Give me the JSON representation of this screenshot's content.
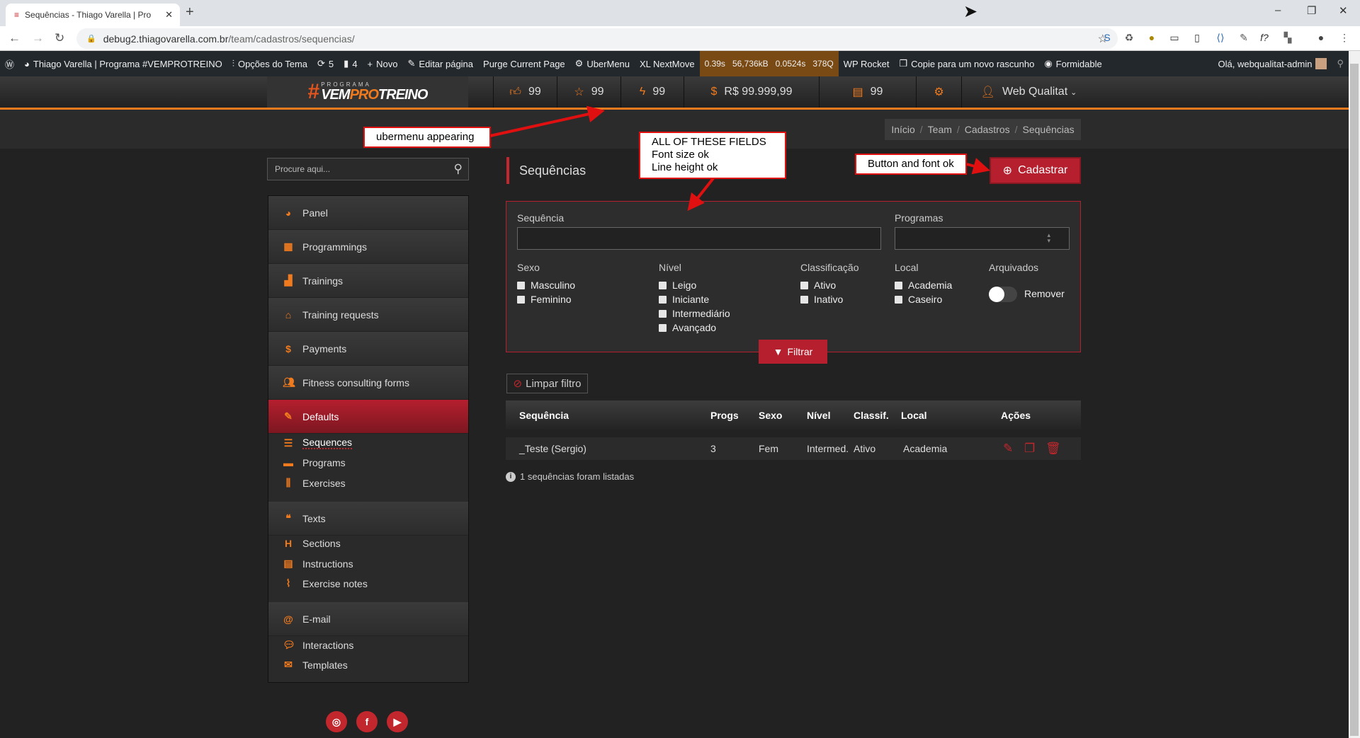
{
  "browser": {
    "tab_title": "Sequências - Thiago Varella | Pro",
    "url_host": "debug2.thiagovarella.com.br",
    "url_path": "/team/cadastros/sequencias/"
  },
  "wpbar": {
    "site": "Thiago Varella | Programa #VEMPROTREINO",
    "theme_options": "Opções do Tema",
    "updates": "5",
    "comments": "4",
    "new": "Novo",
    "edit": "Editar página",
    "purge": "Purge Current Page",
    "ubermenu": "UberMenu",
    "nextmove": "XL NextMove",
    "qm": [
      "0.39s",
      "56,736kB",
      "0.0524s",
      "378Q"
    ],
    "rocket": "WP Rocket",
    "copy": "Copie para um novo rascunho",
    "formidable": "Formidable",
    "greeting": "Olá, webqualitat-admin"
  },
  "header": {
    "logo": {
      "top": "PROGRAMA",
      "a": "VEM",
      "b": "PRO",
      "c": "TREINO"
    },
    "likes": "99",
    "stars": "99",
    "energy": "99",
    "balance": "R$ 99.999,99",
    "docs": "99",
    "user": "Web Qualitat"
  },
  "breadcrumb": [
    "Início",
    "Team",
    "Cadastros",
    "Sequências"
  ],
  "search": {
    "placeholder": "Procure aqui..."
  },
  "sidebar": {
    "items": [
      {
        "label": "Panel",
        "icon": "dashboard-icon"
      },
      {
        "label": "Programmings",
        "icon": "calendar-icon"
      },
      {
        "label": "Trainings",
        "icon": "bar-chart-icon"
      },
      {
        "label": "Training requests",
        "icon": "inbox-icon"
      },
      {
        "label": "Payments",
        "icon": "money-icon"
      },
      {
        "label": "Fitness consulting forms",
        "icon": "users-icon"
      },
      {
        "label": "Defaults",
        "icon": "edit-icon"
      }
    ],
    "defaults_sub": [
      "Sequences",
      "Programs",
      "Exercises"
    ],
    "texts": "Texts",
    "texts_sub": [
      "Sections",
      "Instructions",
      "Exercise notes"
    ],
    "email": "E-mail",
    "email_sub": [
      "Interactions",
      "Templates"
    ]
  },
  "page": {
    "title": "Sequências",
    "add_button": "Cadastrar"
  },
  "filter": {
    "seq_label": "Sequência",
    "seq_value": "",
    "prog_label": "Programas",
    "prog_value": "",
    "sexo": {
      "label": "Sexo",
      "options": [
        "Masculino",
        "Feminino"
      ]
    },
    "nivel": {
      "label": "Nível",
      "options": [
        "Leigo",
        "Iniciante",
        "Intermediário",
        "Avançado"
      ]
    },
    "classif": {
      "label": "Classificação",
      "options": [
        "Ativo",
        "Inativo"
      ]
    },
    "local": {
      "label": "Local",
      "options": [
        "Academia",
        "Caseiro"
      ]
    },
    "arquivados": {
      "label": "Arquivados",
      "toggle": "Remover",
      "on": false
    },
    "submit": "Filtrar",
    "clear": "Limpar filtro"
  },
  "table": {
    "headers": [
      "Sequência",
      "Progs",
      "Sexo",
      "Nível",
      "Classif.",
      "Local",
      "Ações"
    ],
    "rows": [
      [
        "_Teste (Sergio)",
        "3",
        "Fem",
        "Intermed.",
        "Ativo",
        "Academia"
      ]
    ],
    "footer": "1 sequências foram listadas"
  },
  "annotations": {
    "a1": "ubermenu appearing",
    "a2": [
      "ALL OF THESE FIELDS",
      "Font size ok",
      "Line height ok"
    ],
    "a3": "Button and font ok"
  },
  "colors": {
    "accent": "#b51f2e",
    "orange": "#f07a1e",
    "bg": "#222222"
  }
}
